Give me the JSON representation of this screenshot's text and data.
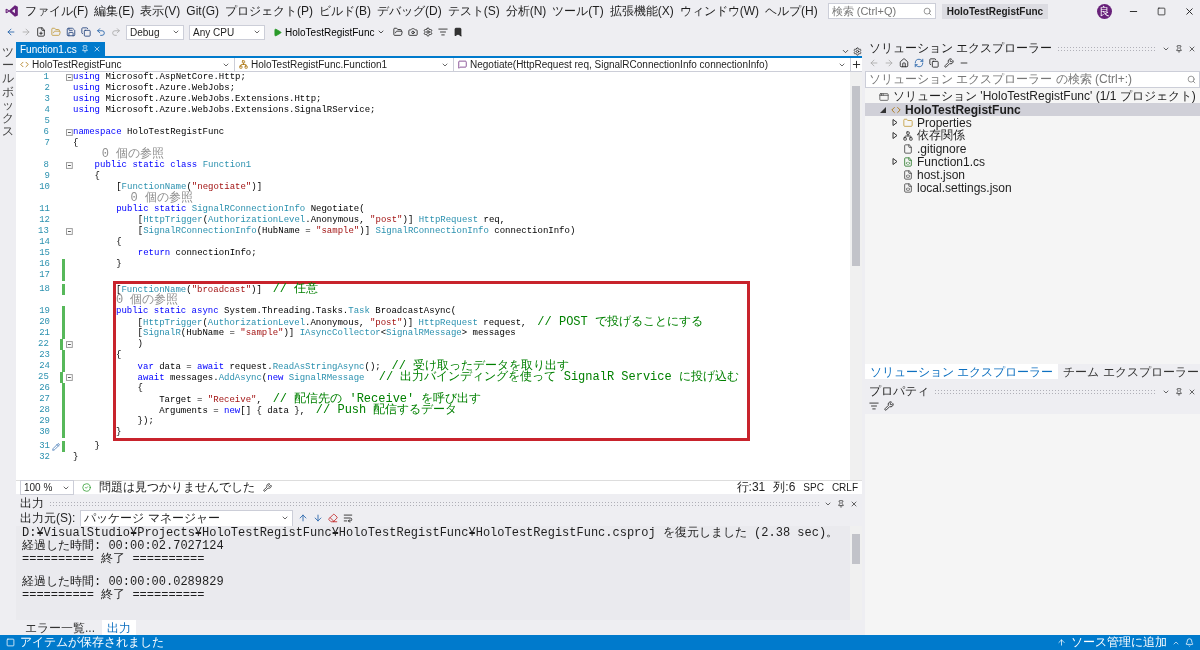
{
  "menu_bar": {
    "menus": [
      "ファイル(F)",
      "編集(E)",
      "表示(V)",
      "Git(G)",
      "プロジェクト(P)",
      "ビルド(B)",
      "デバッグ(D)",
      "テスト(S)",
      "分析(N)",
      "ツール(T)",
      "拡張機能(X)",
      "ウィンドウ(W)",
      "ヘルプ(H)"
    ],
    "search": {
      "placeholder": "検索 (Ctrl+Q)"
    },
    "title": "HoloTestRegistFunc",
    "avatar": "良"
  },
  "toolbar": {
    "configuration": "Debug",
    "platform": "Any CPU",
    "run_target": "HoloTestRegistFunc"
  },
  "toolbox_strip": {
    "label": "ツールボックス"
  },
  "editor": {
    "tabs": [
      {
        "label": "Function1.cs",
        "selected": true
      }
    ],
    "nav": {
      "project": "HoloTestRegistFunc",
      "type": "HoloTestRegistFunc.Function1",
      "member": "Negotiate(HttpRequest req, SignalRConnectionInfo connectionInfo)"
    },
    "code_blocks": [
      {
        "highlighted": false,
        "lines": [
          {
            "kind": "code",
            "number": "1",
            "fold": true,
            "changed": false,
            "quick_action": false,
            "tokens": [
              {
                "kind": "keyword",
                "text": "using"
              },
              {
                "kind": "plain",
                "text": " Microsoft.AspNetCore.Http;"
              }
            ]
          },
          {
            "kind": "code",
            "number": "2",
            "fold": false,
            "changed": false,
            "quick_action": false,
            "tokens": [
              {
                "kind": "keyword",
                "text": "using"
              },
              {
                "kind": "plain",
                "text": " Microsoft.Azure.WebJobs;"
              }
            ]
          },
          {
            "kind": "code",
            "number": "3",
            "fold": false,
            "changed": false,
            "quick_action": false,
            "tokens": [
              {
                "kind": "keyword",
                "text": "using"
              },
              {
                "kind": "plain",
                "text": " Microsoft.Azure.WebJobs.Extensions.Http;"
              }
            ]
          },
          {
            "kind": "code",
            "number": "4",
            "fold": false,
            "changed": false,
            "quick_action": false,
            "tokens": [
              {
                "kind": "keyword",
                "text": "using"
              },
              {
                "kind": "plain",
                "text": " Microsoft.Azure.WebJobs.Extensions.SignalRService;"
              }
            ]
          },
          {
            "kind": "code",
            "number": "5",
            "fold": false,
            "changed": false,
            "quick_action": false
          },
          {
            "kind": "code",
            "number": "6",
            "fold": true,
            "changed": false,
            "quick_action": false,
            "tokens": [
              {
                "kind": "keyword",
                "text": "namespace"
              },
              {
                "kind": "plain",
                "text": " HoloTestRegistFunc"
              }
            ]
          },
          {
            "kind": "code",
            "number": "7",
            "fold": false,
            "changed": false,
            "quick_action": false,
            "tokens": [
              {
                "kind": "plain",
                "text": "{"
              }
            ]
          },
          {
            "kind": "lens",
            "text": "    0 個の参照"
          },
          {
            "kind": "code",
            "number": "8",
            "fold": true,
            "changed": false,
            "quick_action": false,
            "tokens": [
              {
                "kind": "keyword",
                "text": "    public static class"
              },
              {
                "kind": "type",
                "text": " Function1"
              }
            ]
          },
          {
            "kind": "code",
            "number": "9",
            "fold": false,
            "changed": false,
            "quick_action": false,
            "tokens": [
              {
                "kind": "plain",
                "text": "    {"
              }
            ]
          },
          {
            "kind": "code",
            "number": "10",
            "fold": false,
            "changed": false,
            "quick_action": false,
            "tokens": [
              {
                "kind": "plain",
                "text": "        ["
              },
              {
                "kind": "type",
                "text": "FunctionName"
              },
              {
                "kind": "plain",
                "text": "("
              },
              {
                "kind": "string",
                "text": "\"negotiate\""
              },
              {
                "kind": "plain",
                "text": ")]"
              }
            ]
          },
          {
            "kind": "lens",
            "text": "        0 個の参照"
          },
          {
            "kind": "code",
            "number": "11",
            "fold": false,
            "changed": false,
            "quick_action": false,
            "tokens": [
              {
                "kind": "keyword",
                "text": "        public static"
              },
              {
                "kind": "type",
                "text": " SignalRConnectionInfo"
              },
              {
                "kind": "plain",
                "text": " Negotiate("
              }
            ]
          },
          {
            "kind": "code",
            "number": "12",
            "fold": false,
            "changed": false,
            "quick_action": false,
            "tokens": [
              {
                "kind": "plain",
                "text": "            ["
              },
              {
                "kind": "type",
                "text": "HttpTrigger"
              },
              {
                "kind": "plain",
                "text": "("
              },
              {
                "kind": "type",
                "text": "AuthorizationLevel"
              },
              {
                "kind": "plain",
                "text": ".Anonymous, "
              },
              {
                "kind": "string",
                "text": "\"post\""
              },
              {
                "kind": "plain",
                "text": ")] "
              },
              {
                "kind": "type",
                "text": "HttpRequest"
              },
              {
                "kind": "plain",
                "text": " req,"
              }
            ]
          },
          {
            "kind": "code",
            "number": "13",
            "fold": true,
            "changed": false,
            "quick_action": false,
            "tokens": [
              {
                "kind": "plain",
                "text": "            ["
              },
              {
                "kind": "type",
                "text": "SignalRConnectionInfo"
              },
              {
                "kind": "plain",
                "text": "(HubName = "
              },
              {
                "kind": "string",
                "text": "\"sample\""
              },
              {
                "kind": "plain",
                "text": ")] "
              },
              {
                "kind": "type",
                "text": "SignalRConnectionInfo"
              },
              {
                "kind": "plain",
                "text": " connectionInfo)"
              }
            ]
          },
          {
            "kind": "code",
            "number": "14",
            "fold": false,
            "changed": false,
            "quick_action": false,
            "tokens": [
              {
                "kind": "plain",
                "text": "        {"
              }
            ]
          },
          {
            "kind": "code",
            "number": "15",
            "fold": false,
            "changed": false,
            "quick_action": false,
            "tokens": [
              {
                "kind": "keyword",
                "text": "            return"
              },
              {
                "kind": "plain",
                "text": " connectionInfo;"
              }
            ]
          },
          {
            "kind": "code",
            "number": "16",
            "fold": false,
            "changed": true,
            "quick_action": false,
            "tokens": [
              {
                "kind": "plain",
                "text": "        }"
              }
            ]
          },
          {
            "kind": "code",
            "number": "17",
            "fold": false,
            "changed": true,
            "quick_action": false
          }
        ]
      },
      {
        "highlighted": true,
        "lines": [
          {
            "kind": "code",
            "number": "18",
            "fold": false,
            "changed": true,
            "quick_action": false,
            "tokens": [
              {
                "kind": "plain",
                "text": "["
              },
              {
                "kind": "type",
                "text": "FunctionName"
              },
              {
                "kind": "plain",
                "text": "("
              },
              {
                "kind": "string",
                "text": "\"broadcast\""
              },
              {
                "kind": "plain",
                "text": ")]  "
              },
              {
                "kind": "comment",
                "text": "// 任意"
              }
            ]
          },
          {
            "kind": "lens",
            "text": "0 個の参照"
          },
          {
            "kind": "code",
            "number": "19",
            "fold": false,
            "changed": true,
            "quick_action": false,
            "tokens": [
              {
                "kind": "keyword",
                "text": "public static async"
              },
              {
                "kind": "plain",
                "text": " System.Threading.Tasks."
              },
              {
                "kind": "type",
                "text": "Task"
              },
              {
                "kind": "plain",
                "text": " BroadcastAsync("
              }
            ]
          },
          {
            "kind": "code",
            "number": "20",
            "fold": false,
            "changed": true,
            "quick_action": false,
            "tokens": [
              {
                "kind": "plain",
                "text": "    ["
              },
              {
                "kind": "type",
                "text": "HttpTrigger"
              },
              {
                "kind": "plain",
                "text": "("
              },
              {
                "kind": "type",
                "text": "AuthorizationLevel"
              },
              {
                "kind": "plain",
                "text": ".Anonymous, "
              },
              {
                "kind": "string",
                "text": "\"post\""
              },
              {
                "kind": "plain",
                "text": ")] "
              },
              {
                "kind": "type",
                "text": "HttpRequest"
              },
              {
                "kind": "plain",
                "text": " request,  "
              },
              {
                "kind": "comment",
                "text": "// POST で投げることにする"
              }
            ]
          },
          {
            "kind": "code",
            "number": "21",
            "fold": false,
            "changed": true,
            "quick_action": false,
            "tokens": [
              {
                "kind": "plain",
                "text": "    ["
              },
              {
                "kind": "type",
                "text": "SignalR"
              },
              {
                "kind": "plain",
                "text": "(HubName = "
              },
              {
                "kind": "string",
                "text": "\"sample\""
              },
              {
                "kind": "plain",
                "text": ")] "
              },
              {
                "kind": "type",
                "text": "IAsyncCollector"
              },
              {
                "kind": "plain",
                "text": "<"
              },
              {
                "kind": "type",
                "text": "SignalRMessage"
              },
              {
                "kind": "plain",
                "text": "> messages"
              }
            ]
          },
          {
            "kind": "code",
            "number": "22",
            "fold": true,
            "changed": true,
            "quick_action": false,
            "tokens": [
              {
                "kind": "plain",
                "text": "    )"
              }
            ]
          },
          {
            "kind": "code",
            "number": "23",
            "fold": false,
            "changed": true,
            "quick_action": false,
            "tokens": [
              {
                "kind": "plain",
                "text": "{"
              }
            ]
          },
          {
            "kind": "code",
            "number": "24",
            "fold": false,
            "changed": true,
            "quick_action": false,
            "tokens": [
              {
                "kind": "keyword",
                "text": "    var"
              },
              {
                "kind": "plain",
                "text": " data = "
              },
              {
                "kind": "keyword",
                "text": "await"
              },
              {
                "kind": "plain",
                "text": " request."
              },
              {
                "kind": "type",
                "text": "ReadAsStringAsync"
              },
              {
                "kind": "plain",
                "text": "();  "
              },
              {
                "kind": "comment",
                "text": "// 受け取ったデータを取り出す"
              }
            ]
          },
          {
            "kind": "code",
            "number": "25",
            "fold": true,
            "changed": true,
            "quick_action": false,
            "tokens": [
              {
                "kind": "keyword",
                "text": "    await"
              },
              {
                "kind": "plain",
                "text": " messages."
              },
              {
                "kind": "type",
                "text": "AddAsync"
              },
              {
                "kind": "plain",
                "text": "("
              },
              {
                "kind": "keyword",
                "text": "new"
              },
              {
                "kind": "type",
                "text": " SignalRMessage"
              },
              {
                "kind": "comment",
                "text": "  // 出力バインディングを使って SignalR Service に投げ込む"
              }
            ]
          },
          {
            "kind": "code",
            "number": "26",
            "fold": false,
            "changed": true,
            "quick_action": false,
            "tokens": [
              {
                "kind": "plain",
                "text": "    {"
              }
            ]
          },
          {
            "kind": "code",
            "number": "27",
            "fold": false,
            "changed": true,
            "quick_action": false,
            "tokens": [
              {
                "kind": "plain",
                "text": "        Target = "
              },
              {
                "kind": "string",
                "text": "\"Receive\""
              },
              {
                "kind": "plain",
                "text": ",  "
              },
              {
                "kind": "comment",
                "text": "// 配信先の 'Receive' を呼び出す"
              }
            ]
          },
          {
            "kind": "code",
            "number": "28",
            "fold": false,
            "changed": true,
            "quick_action": false,
            "tokens": [
              {
                "kind": "plain",
                "text": "        Arguments = "
              },
              {
                "kind": "keyword",
                "text": "new"
              },
              {
                "kind": "plain",
                "text": "[] { data },  "
              },
              {
                "kind": "comment",
                "text": "// Push 配信するデータ"
              }
            ]
          },
          {
            "kind": "code",
            "number": "29",
            "fold": false,
            "changed": true,
            "quick_action": false,
            "tokens": [
              {
                "kind": "plain",
                "text": "    });"
              }
            ]
          },
          {
            "kind": "code",
            "number": "30",
            "fold": false,
            "changed": true,
            "quick_action": false,
            "tokens": [
              {
                "kind": "plain",
                "text": "}"
              }
            ]
          }
        ]
      },
      {
        "highlighted": false,
        "lines": [
          {
            "kind": "code",
            "number": "31",
            "fold": false,
            "changed": true,
            "quick_action": true,
            "tokens": [
              {
                "kind": "plain",
                "text": "    }"
              }
            ]
          },
          {
            "kind": "code",
            "number": "32",
            "fold": false,
            "changed": false,
            "quick_action": false,
            "tokens": [
              {
                "kind": "plain",
                "text": "}"
              }
            ]
          }
        ]
      }
    ],
    "status": {
      "zoom": "100 %",
      "issues": "問題は見つかりませんでした",
      "line": "行:31",
      "column": "列:6",
      "spacing": "SPC",
      "line_ending": "CRLF"
    }
  },
  "output": {
    "title": "出力",
    "source_label": "出力元(S):",
    "source": "パッケージ マネージャー",
    "groups": [
      {
        "lines": [
          "D:¥VisualStudio¥Projects¥HoloTestRegistFunc¥HoloTestRegistFunc¥HoloTestRegistFunc.csproj を復元しました (2.38 sec)。",
          "経過した時間: 00:00:02.7027124",
          "========== 終了 =========="
        ]
      },
      {
        "lines": [
          "経過した時間: 00:00:00.0289829",
          "========== 終了 =========="
        ]
      }
    ],
    "tabs": [
      {
        "label": "エラー一覧...",
        "selected": false
      },
      {
        "label": "出力",
        "selected": true
      }
    ]
  },
  "solution_explorer": {
    "title": "ソリューション エクスプローラー",
    "search": {
      "placeholder": "ソリューション エクスプローラー の検索 (Ctrl+:)"
    },
    "tree": [
      {
        "label": "ソリューション 'HoloTestRegistFunc' (1/1 プロジェクト)",
        "kind": "solution",
        "expandable": false,
        "selected": false,
        "children": [
          {
            "label": "HoloTestRegistFunc",
            "kind": "project",
            "expandable": true,
            "expanded": true,
            "selected": true,
            "children": [
              {
                "label": "Properties",
                "kind": "folder",
                "expandable": true,
                "expanded": false,
                "selected": false
              },
              {
                "label": "依存関係",
                "kind": "dependencies",
                "expandable": true,
                "expanded": false,
                "selected": false
              },
              {
                "label": ".gitignore",
                "kind": "file",
                "expandable": false,
                "selected": false
              },
              {
                "label": "Function1.cs",
                "kind": "csharp",
                "expandable": true,
                "expanded": false,
                "selected": false
              },
              {
                "label": "host.json",
                "kind": "json",
                "expandable": false,
                "selected": false
              },
              {
                "label": "local.settings.json",
                "kind": "json",
                "expandable": false,
                "selected": false
              }
            ]
          }
        ]
      }
    ],
    "tabs": [
      {
        "label": "ソリューション エクスプローラー",
        "selected": true
      },
      {
        "label": "チーム エクスプローラー",
        "selected": false
      }
    ]
  },
  "properties": {
    "title": "プロパティ"
  },
  "status_bar": {
    "message": "アイテムが保存されました",
    "source_control": "ソース管理に追加"
  }
}
